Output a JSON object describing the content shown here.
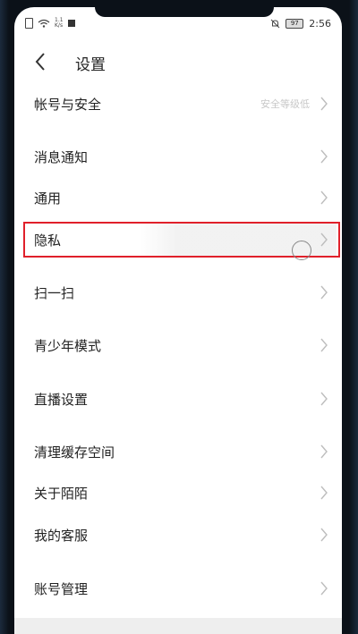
{
  "status": {
    "speed_top": "1.1",
    "speed_bottom": "K/s",
    "battery": "97",
    "time": "2:56"
  },
  "header": {
    "title": "设置"
  },
  "rows": [
    {
      "label": "帐号与安全",
      "hint": "安全等级低"
    },
    {
      "label": "消息通知"
    },
    {
      "label": "通用"
    },
    {
      "label": "隐私"
    },
    {
      "label": "扫一扫"
    },
    {
      "label": "青少年模式"
    },
    {
      "label": "直播设置"
    },
    {
      "label": "清理缓存空间"
    },
    {
      "label": "关于陌陌"
    },
    {
      "label": "我的客服"
    },
    {
      "label": "账号管理"
    }
  ],
  "colors": {
    "highlight": "#e0202a",
    "chevron": "#bdbdbd"
  }
}
